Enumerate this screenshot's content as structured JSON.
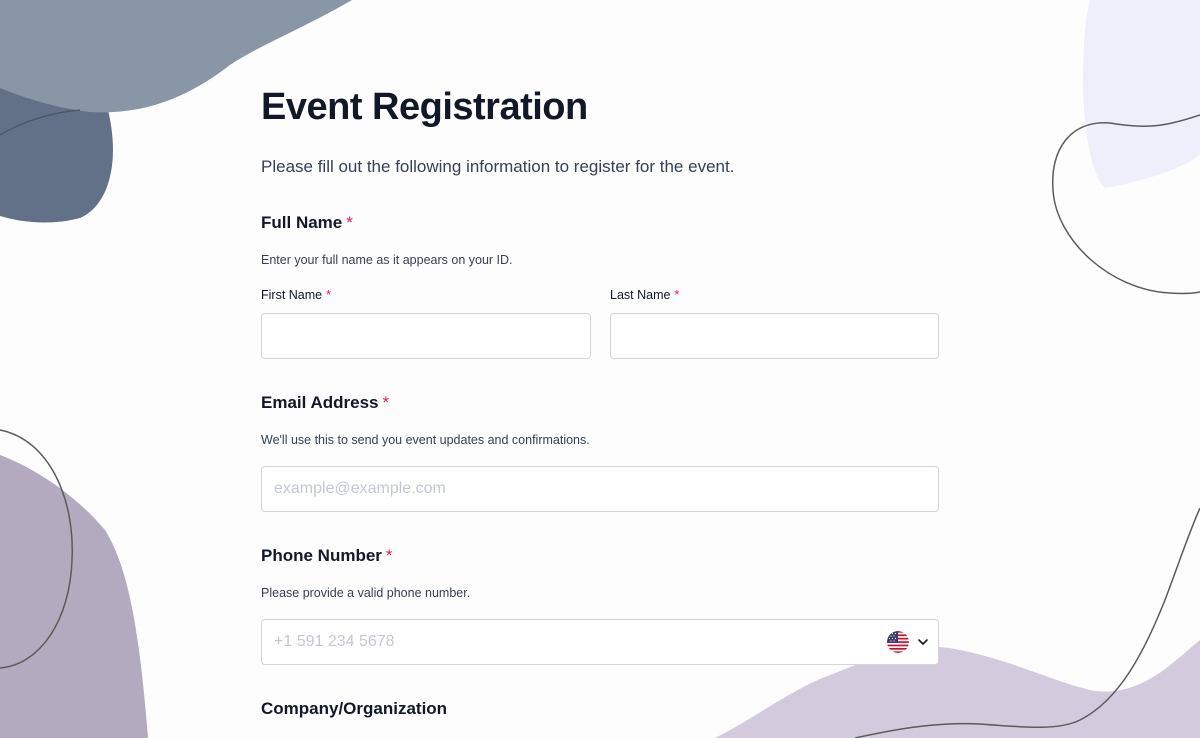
{
  "form": {
    "title": "Event Registration",
    "intro": "Please fill out the following information to register for the event.",
    "required_marker": "*"
  },
  "full_name": {
    "label": "Full Name",
    "hint": "Enter your full name as it appears on your ID.",
    "first_label": "First Name",
    "first_value": "",
    "last_label": "Last Name",
    "last_value": ""
  },
  "email": {
    "label": "Email Address",
    "hint": "We'll use this to send you event updates and confirmations.",
    "placeholder": "example@example.com",
    "value": ""
  },
  "phone": {
    "label": "Phone Number",
    "hint": "Please provide a valid phone number.",
    "placeholder": "+1 591 234 5678",
    "value": "",
    "country_icon": "us-flag-icon",
    "dropdown_icon": "chevron-down-icon"
  },
  "company": {
    "label": "Company/Organization"
  },
  "colors": {
    "blob_top_left_light": "#8896a6",
    "blob_top_left_dark": "#627187",
    "blob_right_top": "#efeffc",
    "blob_bottom_left": "#b3aabf",
    "blob_bottom_right": "#d3cbdd",
    "required": "#e11d48",
    "input_border": "#d1d5db",
    "placeholder": "#c3c8d0"
  }
}
